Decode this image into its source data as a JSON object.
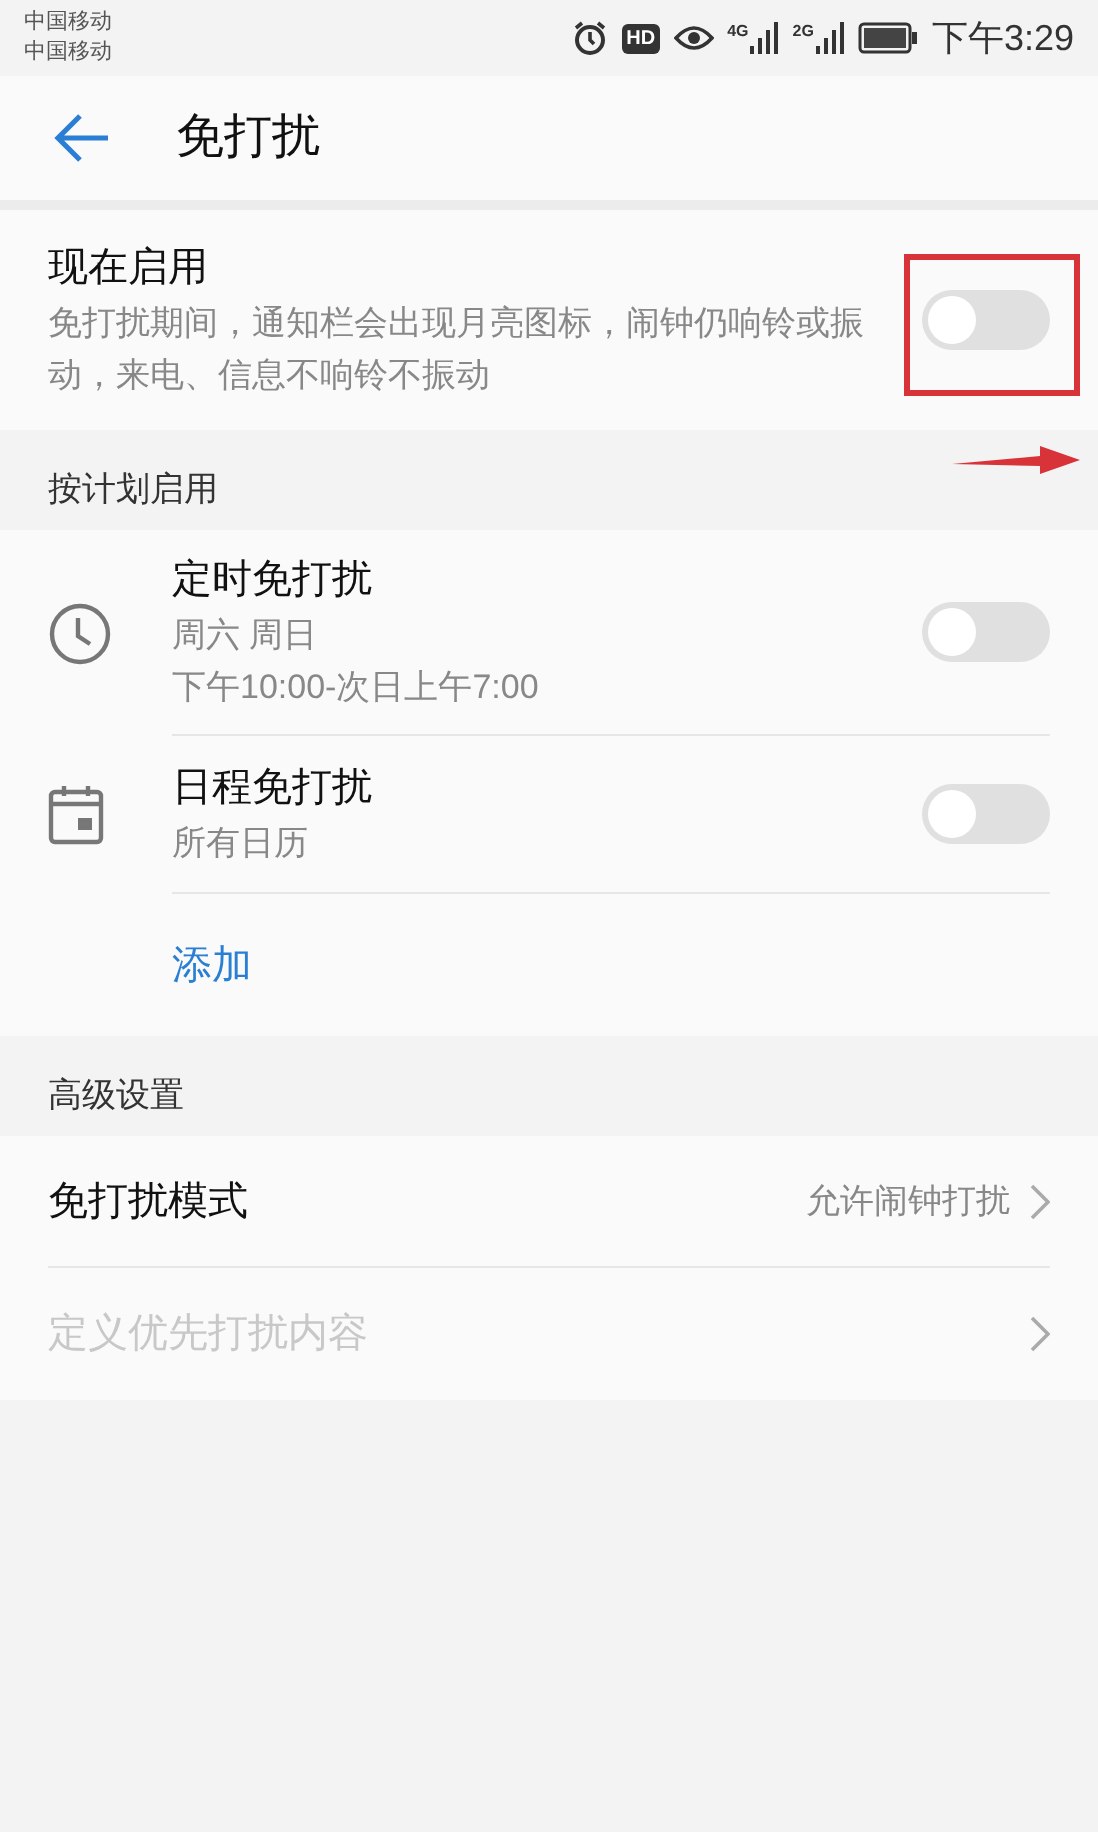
{
  "status_bar": {
    "carriers": [
      "中国移动",
      "中国移动"
    ],
    "hd_badge": "HD",
    "networks": [
      "4G",
      "2G"
    ],
    "time": "下午3:29"
  },
  "header": {
    "title": "免打扰"
  },
  "now": {
    "title": "现在启用",
    "description": "免打扰期间，通知栏会出现月亮图标，闹钟仍响铃或振动，来电、信息不响铃不振动",
    "on": false
  },
  "schedule": {
    "header": "按计划启用",
    "items": [
      {
        "kind": "timer",
        "title": "定时免打扰",
        "lines": [
          "周六 周日",
          "下午10:00-次日上午7:00"
        ],
        "on": false
      },
      {
        "kind": "calendar",
        "title": "日程免打扰",
        "lines": [
          "所有日历"
        ],
        "on": false
      }
    ],
    "add_label": "添加"
  },
  "advanced": {
    "header": "高级设置",
    "items": [
      {
        "title": "免打扰模式",
        "value": "允许闹钟打扰",
        "disabled": false
      },
      {
        "title": "定义优先打扰内容",
        "disabled": true
      }
    ]
  }
}
